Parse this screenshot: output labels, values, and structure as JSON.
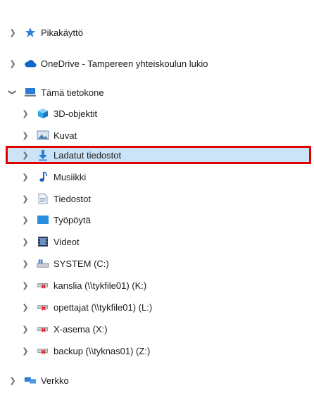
{
  "tree": {
    "items": [
      {
        "label": "Pikakäyttö",
        "icon": "star-pin-icon",
        "level": 0,
        "expanded": false
      },
      {
        "label": "OneDrive - Tampereen yhteiskoulun lukio",
        "icon": "cloud-icon",
        "level": 0,
        "expanded": false
      },
      {
        "label": "Tämä tietokone",
        "icon": "computer-icon",
        "level": 0,
        "expanded": true
      },
      {
        "label": "3D-objektit",
        "icon": "cube-3d-icon",
        "level": 1,
        "expanded": false
      },
      {
        "label": "Kuvat",
        "icon": "pictures-icon",
        "level": 1,
        "expanded": false
      },
      {
        "label": "Ladatut tiedostot",
        "icon": "download-arrow-icon",
        "level": 1,
        "expanded": false,
        "selected": true
      },
      {
        "label": "Musiikki",
        "icon": "music-note-icon",
        "level": 1,
        "expanded": false
      },
      {
        "label": "Tiedostot",
        "icon": "document-icon",
        "level": 1,
        "expanded": false
      },
      {
        "label": "Työpöytä",
        "icon": "desktop-icon",
        "level": 1,
        "expanded": false
      },
      {
        "label": "Videot",
        "icon": "film-icon",
        "level": 1,
        "expanded": false
      },
      {
        "label": "SYSTEM (C:)",
        "icon": "windows-drive-icon",
        "level": 1,
        "expanded": false
      },
      {
        "label": "kanslia (\\\\tykfile01) (K:)",
        "icon": "disconnected-network-drive-icon",
        "level": 1,
        "expanded": false
      },
      {
        "label": "opettajat (\\\\tykfile01) (L:)",
        "icon": "disconnected-network-drive-icon",
        "level": 1,
        "expanded": false
      },
      {
        "label": "X-asema (X:)",
        "icon": "disconnected-network-drive-icon",
        "level": 1,
        "expanded": false
      },
      {
        "label": "backup (\\\\tyknas01) (Z:)",
        "icon": "disconnected-network-drive-icon",
        "level": 1,
        "expanded": false
      },
      {
        "label": "Verkko",
        "icon": "network-icon",
        "level": 0,
        "expanded": false
      }
    ]
  },
  "colors": {
    "selection_bg": "#cce4f7",
    "highlight_border": "#e00000",
    "chevron": "#6b6b6b"
  }
}
